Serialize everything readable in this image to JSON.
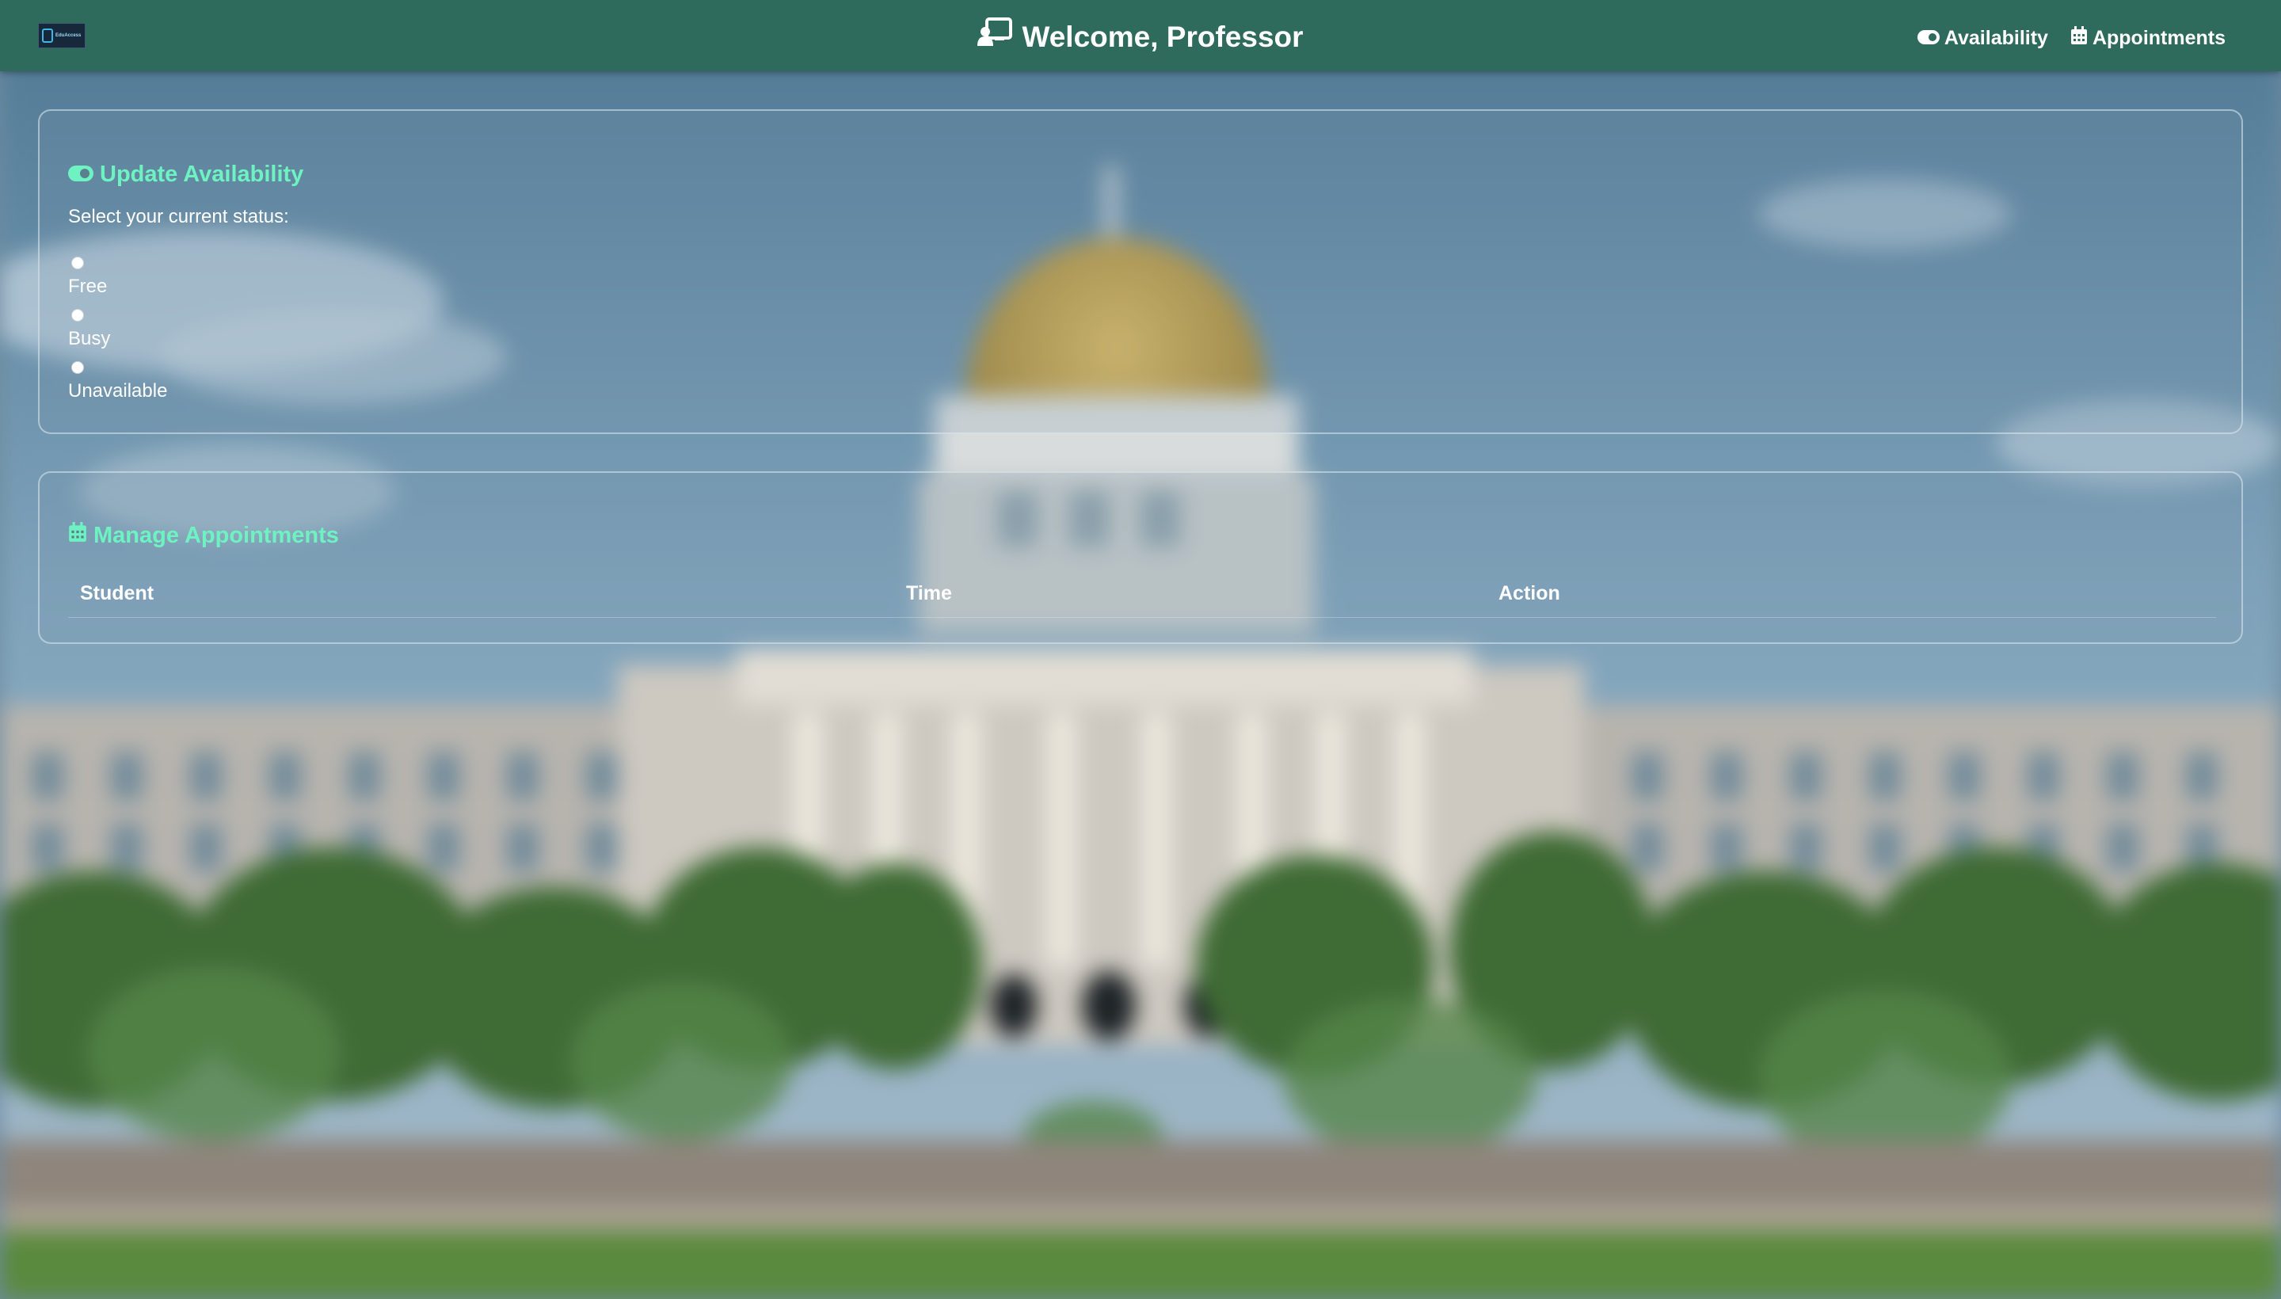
{
  "header": {
    "logo_alt": "logo",
    "title": "Welcome, Professor",
    "title_icon": "chalkboard-teacher-icon",
    "nav": [
      {
        "label": "Availability",
        "icon": "toggle-on-icon"
      },
      {
        "label": "Appointments",
        "icon": "calendar-icon"
      }
    ]
  },
  "availability": {
    "title": "Update Availability",
    "icon": "toggle-on-icon",
    "prompt": "Select your current status:",
    "options": [
      "Free",
      "Busy",
      "Unavailable"
    ]
  },
  "appointments": {
    "title": "Manage Appointments",
    "icon": "calendar-icon",
    "columns": [
      "Student",
      "Time",
      "Action"
    ],
    "rows": []
  },
  "colors": {
    "header_bg": "#2f6b5c",
    "accent": "#6ff2c2",
    "text": "#ffffff"
  }
}
